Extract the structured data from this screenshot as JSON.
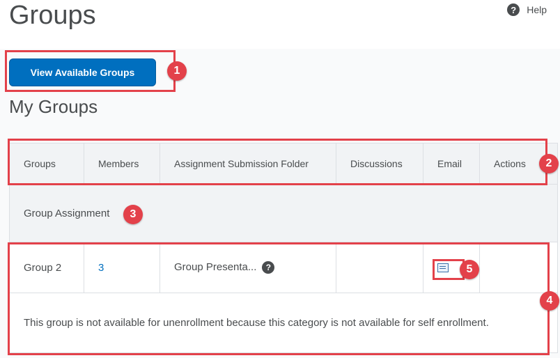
{
  "page": {
    "title": "Groups",
    "help_label": "Help"
  },
  "actions": {
    "view_groups_label": "View Available Groups"
  },
  "section": {
    "title": "My Groups"
  },
  "table": {
    "columns": [
      "Groups",
      "Members",
      "Assignment Submission Folder",
      "Discussions",
      "Email",
      "Actions"
    ],
    "category": "Group Assignment",
    "group": {
      "name": "Group 2",
      "members": "3",
      "folder": "Group Presenta...",
      "discussions": "",
      "actions": ""
    },
    "message": "This group is not available for unenrollment because this category is not available for self enrollment."
  },
  "callouts": [
    "1",
    "2",
    "3",
    "4",
    "5"
  ],
  "colors": {
    "accent": "#006fbf",
    "callout": "#e3414a"
  },
  "icons": {
    "help": "help-icon",
    "question": "question-icon",
    "email": "email-icon"
  }
}
